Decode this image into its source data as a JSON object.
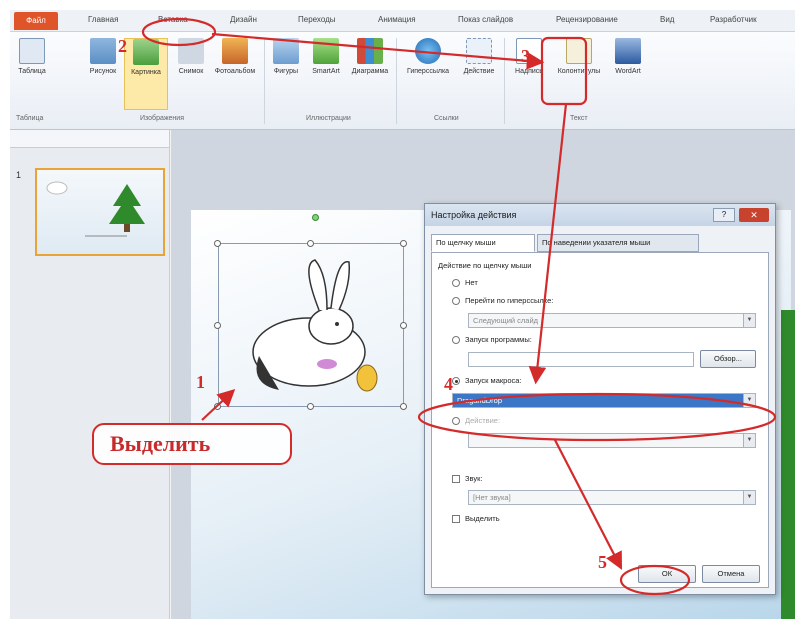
{
  "tabs": [
    {
      "label": "Файл"
    },
    {
      "label": "Главная"
    },
    {
      "label": "Вставка"
    },
    {
      "label": "Дизайн"
    },
    {
      "label": "Переходы"
    },
    {
      "label": "Анимация"
    },
    {
      "label": "Показ слайдов"
    },
    {
      "label": "Рецензирование"
    },
    {
      "label": "Вид"
    },
    {
      "label": "Разработчик"
    }
  ],
  "ribbon": {
    "buttons": [
      {
        "label": "Таблица",
        "icon": "table-icon"
      },
      {
        "label": "Рисунок",
        "icon": "picture-icon"
      },
      {
        "label": "Картинка",
        "icon": "clipart-icon"
      },
      {
        "label": "Снимок",
        "icon": "screenshot-icon"
      },
      {
        "label": "Фотоальбом",
        "icon": "photo-album-icon"
      },
      {
        "label": "Фигуры",
        "icon": "shapes-icon"
      },
      {
        "label": "SmartArt",
        "icon": "smartart-icon"
      },
      {
        "label": "Диаграмма",
        "icon": "chart-icon"
      },
      {
        "label": "Гиперссылка",
        "icon": "hyperlink-icon"
      },
      {
        "label": "Действие",
        "icon": "action-icon"
      },
      {
        "label": "Надпись",
        "icon": "textbox-icon"
      },
      {
        "label": "Колонтитулы",
        "icon": "header-footer-icon"
      },
      {
        "label": "WordArt",
        "icon": "wordart-icon"
      }
    ],
    "groups": [
      "Таблица",
      "Изображения",
      "Иллюстрации",
      "Ссылки",
      "Текст"
    ]
  },
  "slides": [
    {
      "number": "1"
    }
  ],
  "dialog": {
    "title": "Настройка действия",
    "help": "?",
    "close": "✕",
    "tabs": [
      "По щелчку мыши",
      "По наведении указателя мыши"
    ],
    "section": "Действие по щелчку мыши",
    "options": {
      "none": "Нет",
      "hyperlink": "Перейти по гиперссылке:",
      "hyperlink_value": "Следующий слайд",
      "program": "Запуск программы:",
      "browse": "Обзор...",
      "macro": "Запуск макроса:",
      "macro_value": "DragandDrop",
      "object_action": "Действие:"
    },
    "sound_label": "Звук:",
    "sound_value": "[Нет звука]",
    "highlight_label": "Выделить",
    "ok": "ОК",
    "cancel": "Отмена"
  },
  "annotations": {
    "n1": "1",
    "n2": "2",
    "n3": "3",
    "n4": "4",
    "n5": "5",
    "callout": "Выделить",
    "color": "#d42a2a"
  }
}
